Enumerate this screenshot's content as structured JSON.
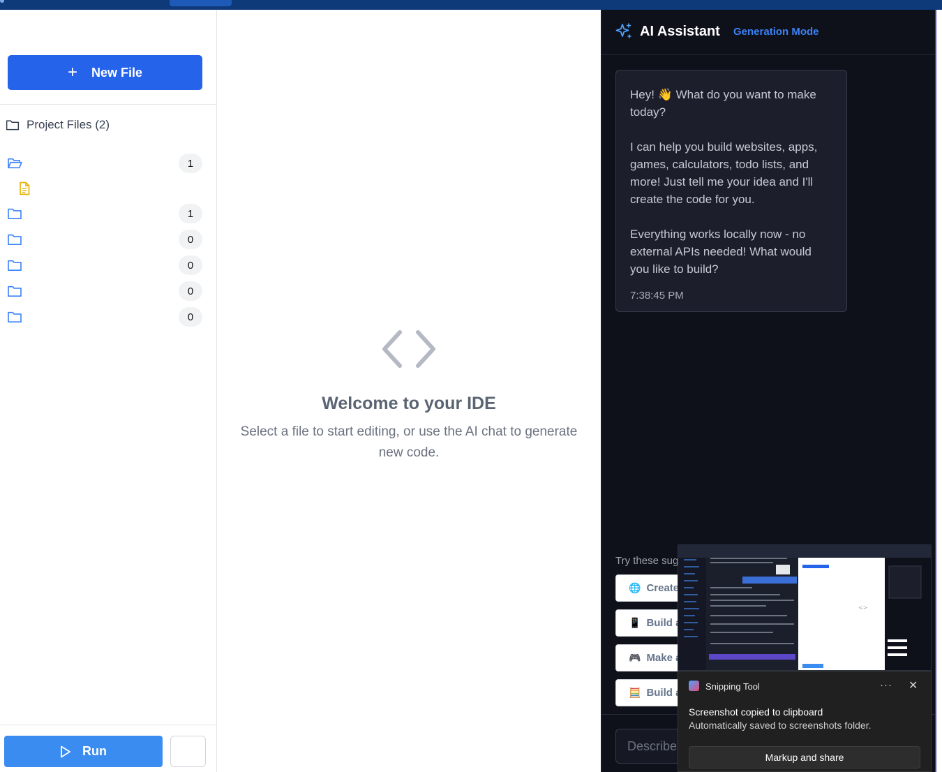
{
  "sidebar": {
    "new_file_label": "New File",
    "project_files_label": "Project Files (2)",
    "folders": [
      {
        "count": "1",
        "open": true
      },
      {
        "count": "1",
        "open": false
      },
      {
        "count": "0",
        "open": false
      },
      {
        "count": "0",
        "open": false
      },
      {
        "count": "0",
        "open": false
      },
      {
        "count": "0",
        "open": false
      }
    ],
    "run_label": "Run"
  },
  "editor": {
    "welcome_title": "Welcome to your IDE",
    "welcome_text": "Select a file to start editing, or use the AI chat to generate new code."
  },
  "ai_panel": {
    "title": "AI Assistant",
    "mode_label": "Generation Mode",
    "message": {
      "p1": "Hey! 👋 What do you want to make today?",
      "p2": "I can help you build websites, apps, games, calculators, todo lists, and more! Just tell me your idea and I'll create the code for you.",
      "p3": "Everything works locally now - no external APIs needed! What would you like to build?",
      "time": "7:38:45 PM"
    },
    "suggestions_label": "Try these sugg",
    "suggestions": [
      {
        "icon": "🌐",
        "label": "Create"
      },
      {
        "icon": "📱",
        "label": "Build a"
      },
      {
        "icon": "🎮",
        "label": "Make a"
      },
      {
        "icon": "🧮",
        "label": "Build a"
      }
    ],
    "input_placeholder": "Describe v"
  },
  "notification": {
    "app_name": "Snipping Tool",
    "more_label": "···",
    "close_label": "✕",
    "title": "Screenshot copied to clipboard",
    "body": "Automatically saved to screenshots folder.",
    "action_label": "Markup and share"
  },
  "colors": {
    "accent": "#2563eb",
    "run": "#3b8cf0",
    "ai_bg": "#0f111a",
    "mode_link": "#3b82f6"
  }
}
